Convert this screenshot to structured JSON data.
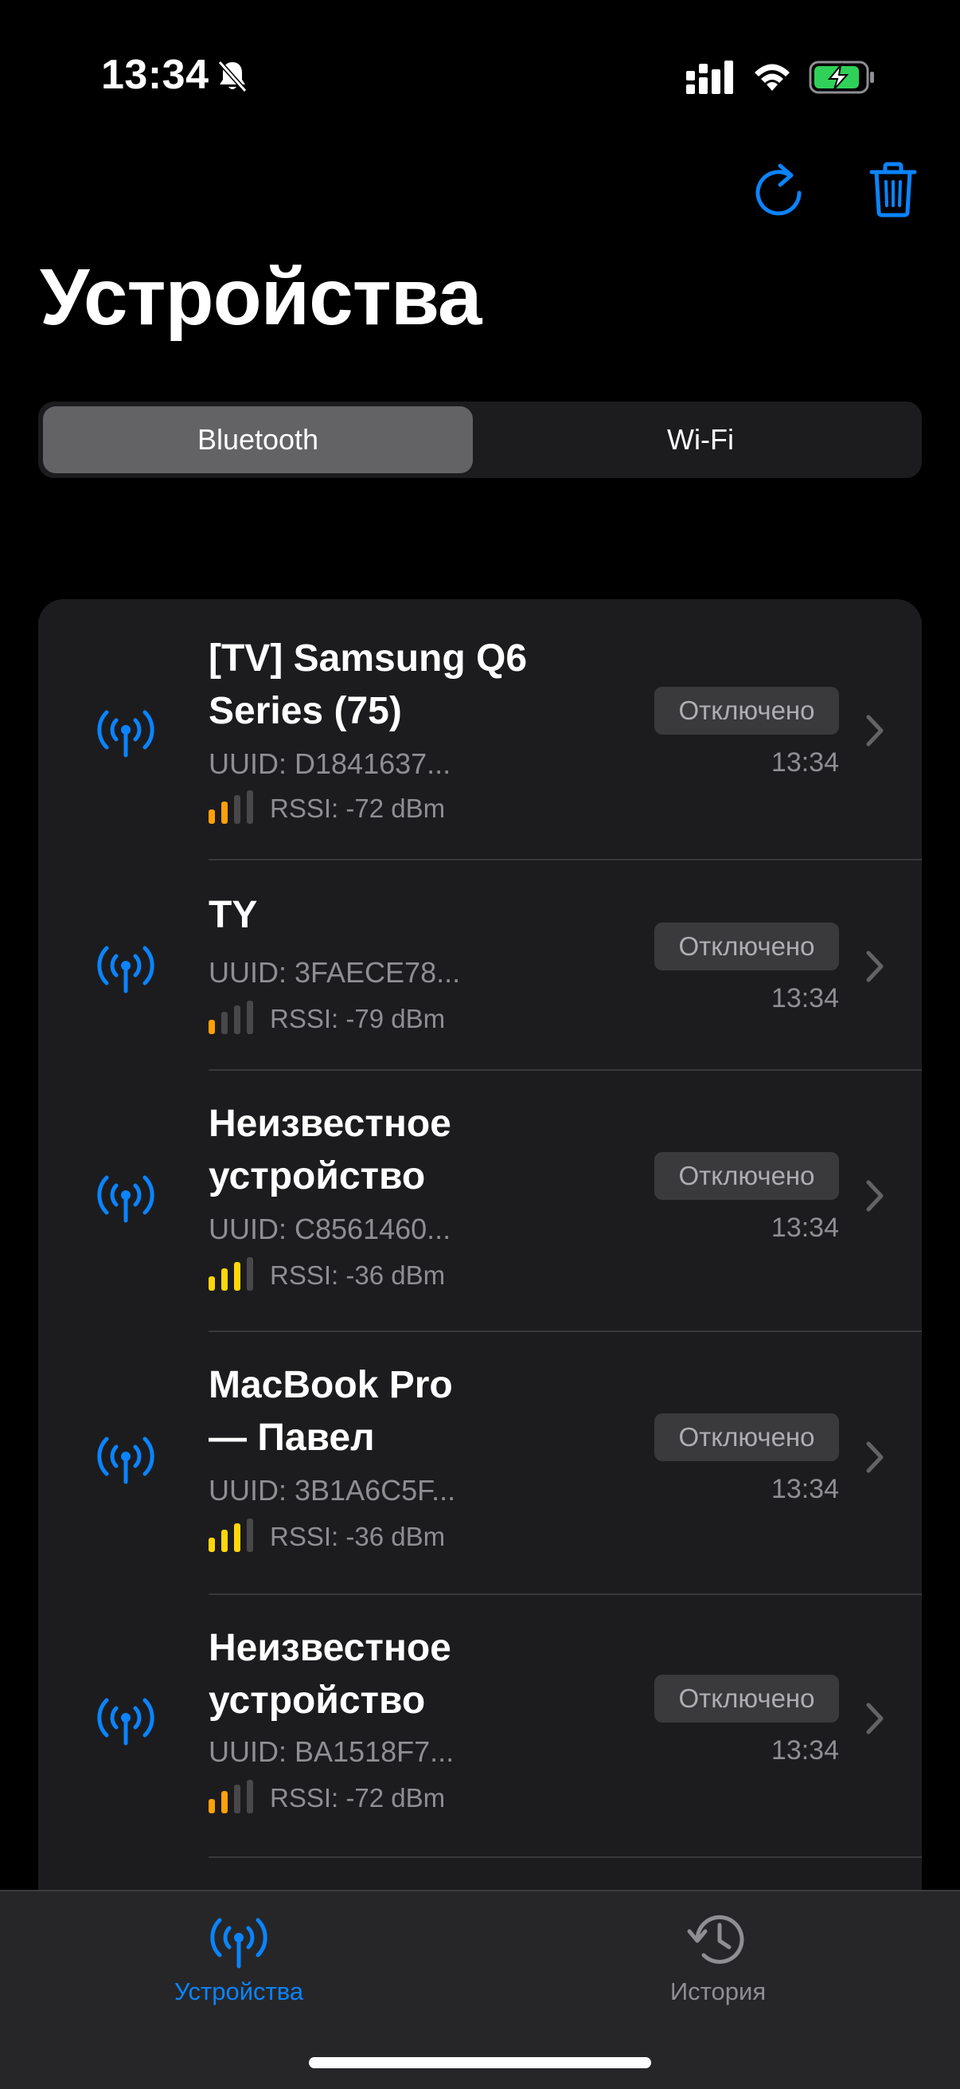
{
  "status_bar": {
    "time": "13:34",
    "silent_icon": "bell-slash-icon",
    "signal_icon": "cellular-signal-icon",
    "wifi_icon": "wifi-icon",
    "battery_icon": "battery-charging-icon"
  },
  "toolbar": {
    "refresh_icon": "refresh-icon",
    "trash_icon": "trash-icon",
    "accent_color": "#0a84ff"
  },
  "page": {
    "title": "Устройства"
  },
  "segmented": {
    "bluetooth_label": "Bluetooth",
    "wifi_label": "Wi-Fi",
    "selected": "Bluetooth"
  },
  "devices": [
    {
      "name": "[TV] Samsung Q6 Series (75)",
      "uuid": "UUID: D1841637...",
      "rssi": "RSSI: -72 dBm",
      "signal_level": 2,
      "signal_color": "#ff9f0a",
      "status": "Отключено",
      "time": "13:34"
    },
    {
      "name": "TY",
      "uuid": "UUID: 3FAECE78...",
      "rssi": "RSSI: -79 dBm",
      "signal_level": 1,
      "signal_color": "#ff9f0a",
      "status": "Отключено",
      "time": "13:34"
    },
    {
      "name": "Неизвестное устройство",
      "uuid": "UUID: C8561460...",
      "rssi": "RSSI: -36 dBm",
      "signal_level": 3,
      "signal_color": "#ffd60a",
      "status": "Отключено",
      "time": "13:34"
    },
    {
      "name": "MacBook Pro — Павел",
      "uuid": "UUID: 3B1A6C5F...",
      "rssi": "RSSI: -36 dBm",
      "signal_level": 3,
      "signal_color": "#ffd60a",
      "status": "Отключено",
      "time": "13:34"
    },
    {
      "name": "Неизвестное устройство",
      "uuid": "UUID: BA1518F7...",
      "rssi": "RSSI: -72 dBm",
      "signal_level": 2,
      "signal_color": "#ff9f0a",
      "status": "Отключено",
      "time": "13:34"
    }
  ],
  "tab_bar": {
    "devices_label": "Устройства",
    "devices_icon": "antenna-icon",
    "history_label": "История",
    "history_icon": "history-icon",
    "selected": "Устройства"
  }
}
